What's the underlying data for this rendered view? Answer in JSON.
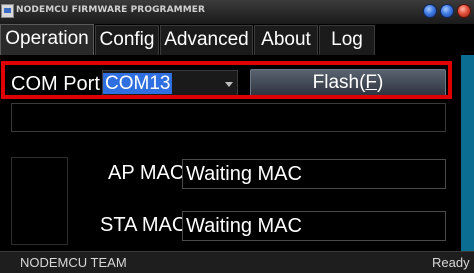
{
  "window": {
    "title": "NODEMCU FIRMWARE PROGRAMMER",
    "icon": "app-icon"
  },
  "tabs": [
    {
      "label": "Operation",
      "active": true
    },
    {
      "label": "Config",
      "active": false
    },
    {
      "label": "Advanced",
      "active": false
    },
    {
      "label": "About",
      "active": false
    },
    {
      "label": "Log",
      "active": false
    }
  ],
  "operation": {
    "com_port_label": "COM Port",
    "com_port_value": "COM13",
    "flash_button": {
      "text": "Flash(",
      "mnemonic": "F",
      "suffix": ")"
    },
    "ap_mac_label": "AP MAC",
    "ap_mac_value": "Waiting MAC",
    "sta_mac_label": "STA MAC",
    "sta_mac_value": "Waiting MAC"
  },
  "status": {
    "left": "NODEMCU TEAM",
    "right": "Ready"
  },
  "colors": {
    "highlight_box": "#e00000",
    "selection": "#2f6fe0",
    "accent_stripe": "#0b6d92"
  }
}
